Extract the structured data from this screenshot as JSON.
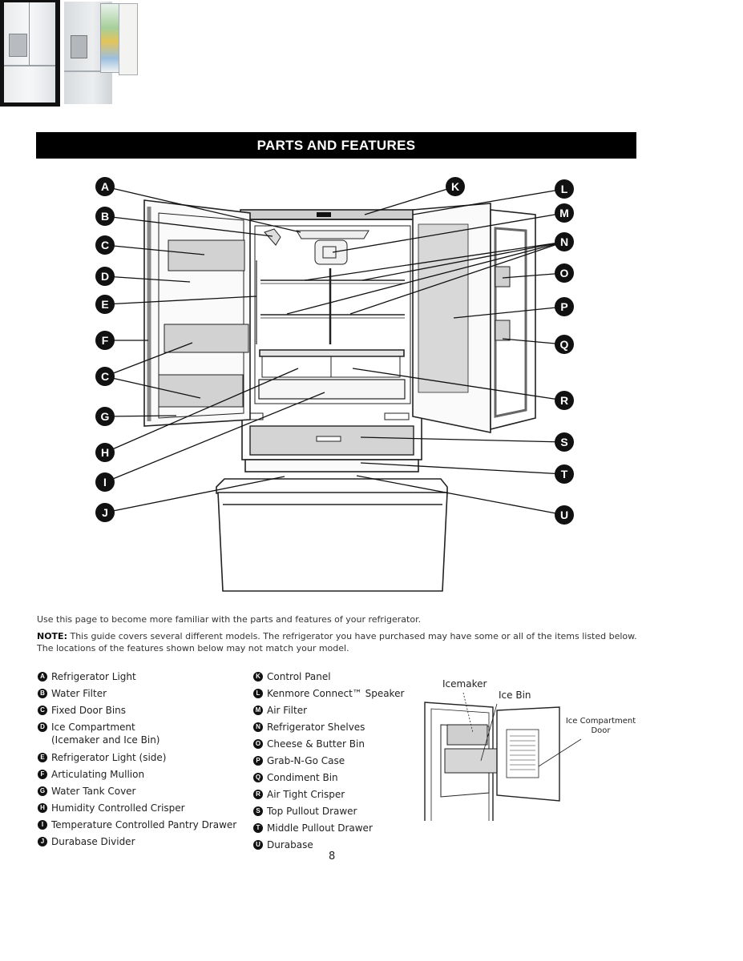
{
  "header": {
    "title": "PARTS AND FEATURES"
  },
  "thumbnails": [
    {
      "name": "closed-refrigerator-photo",
      "state": "doors closed"
    },
    {
      "name": "open-refrigerator-photo",
      "state": "door open with food"
    }
  ],
  "diagram": {
    "markers": [
      "A",
      "B",
      "C",
      "D",
      "E",
      "F",
      "C",
      "G",
      "H",
      "I",
      "J",
      "K",
      "L",
      "M",
      "N",
      "O",
      "P",
      "Q",
      "R",
      "S",
      "T",
      "U"
    ]
  },
  "intro": {
    "line1": "Use this page to become more familiar with the parts and features of your refrigerator.",
    "note_label": "NOTE:",
    "note_text": " This guide covers several different models. The refrigerator you have purchased may have some or all of the items listed below. The locations of the features shown below may not match your model."
  },
  "parts_left": [
    {
      "letter": "A",
      "label": "Refrigerator Light"
    },
    {
      "letter": "B",
      "label": "Water Filter"
    },
    {
      "letter": "C",
      "label": "Fixed Door Bins"
    },
    {
      "letter": "D",
      "label": "Ice Compartment",
      "label2": "(Icemaker and Ice Bin)"
    },
    {
      "letter": "E",
      "label": "Refrigerator Light (side)"
    },
    {
      "letter": "F",
      "label": "Articulating Mullion"
    },
    {
      "letter": "G",
      "label": "Water Tank Cover"
    },
    {
      "letter": "H",
      "label": "Humidity Controlled Crisper"
    },
    {
      "letter": "I",
      "label": "Temperature Controlled Pantry Drawer"
    },
    {
      "letter": "J",
      "label": "Durabase Divider"
    }
  ],
  "parts_right": [
    {
      "letter": "K",
      "label": "Control Panel"
    },
    {
      "letter": "L",
      "label": "Kenmore Connect™ Speaker"
    },
    {
      "letter": "M",
      "label": "Air Filter"
    },
    {
      "letter": "N",
      "label": "Refrigerator Shelves"
    },
    {
      "letter": "O",
      "label": "Cheese & Butter Bin"
    },
    {
      "letter": "P",
      "label": "Grab-N-Go Case"
    },
    {
      "letter": "Q",
      "label": "Condiment Bin"
    },
    {
      "letter": "R",
      "label": "Air Tight Crisper"
    },
    {
      "letter": "S",
      "label": "Top Pullout Drawer"
    },
    {
      "letter": "T",
      "label": "Middle Pullout Drawer"
    },
    {
      "letter": "U",
      "label": "Durabase"
    }
  ],
  "inset": {
    "icemaker": "Icemaker",
    "ice_bin": "Ice Bin",
    "door_line1": "Ice Compartment",
    "door_line2": "Door"
  },
  "page_number": "8"
}
